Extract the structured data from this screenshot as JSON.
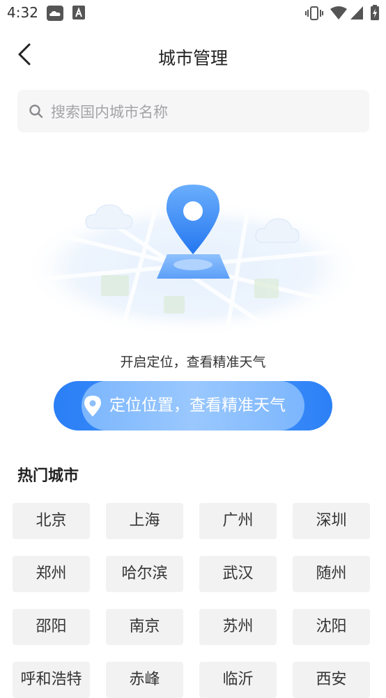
{
  "status_bar": {
    "time": "4:32",
    "icons": [
      "weather-app-icon",
      "notification-a-icon",
      "vibrate-icon",
      "wifi-icon",
      "signal-icon",
      "battery-charging-icon"
    ]
  },
  "header": {
    "title": "城市管理",
    "back_icon": "chevron-left-icon"
  },
  "search": {
    "placeholder": "搜索国内城市名称",
    "icon": "search-icon"
  },
  "location": {
    "hint": "开启定位，查看精准天气",
    "button_label": "定位位置，查看精准天气",
    "button_icon": "location-pin-icon"
  },
  "hot_cities": {
    "title": "热门城市",
    "cities": [
      "北京",
      "上海",
      "广州",
      "深圳",
      "郑州",
      "哈尔滨",
      "武汉",
      "随州",
      "邵阳",
      "南京",
      "苏州",
      "沈阳",
      "呼和浩特",
      "赤峰",
      "临沂",
      "西安"
    ]
  },
  "colors": {
    "accent": "#2b7ff5",
    "accent_light": "#9ac8fe",
    "chip_bg": "#f2f2f3",
    "search_bg": "#f6f6f7"
  }
}
